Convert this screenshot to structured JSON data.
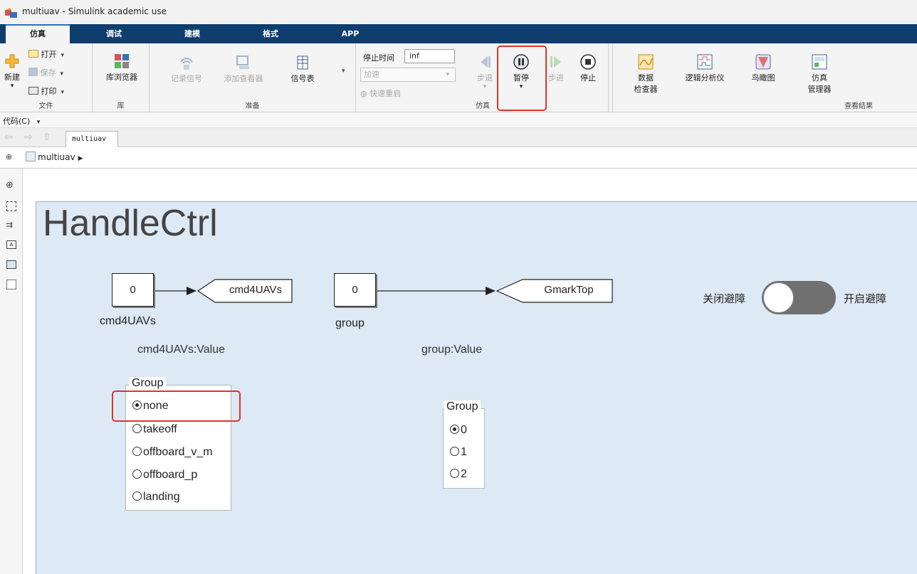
{
  "window": {
    "title": "multiuav - Simulink academic use"
  },
  "tabs": [
    {
      "label": "仿真",
      "active": true
    },
    {
      "label": "调试",
      "active": false
    },
    {
      "label": "建模",
      "active": false
    },
    {
      "label": "格式",
      "active": false
    },
    {
      "label": "APP",
      "active": false
    }
  ],
  "ribbon": {
    "file": {
      "new": "新建",
      "open": "打开",
      "save": "保存",
      "print": "打印",
      "section": "文件"
    },
    "library": {
      "browser": "库浏览器",
      "section": "库"
    },
    "prepare": {
      "record_signal": "记录信号",
      "add_viewer": "添加查看器",
      "signal_table": "信号表",
      "section": "准备"
    },
    "simulation": {
      "stop_time_label": "停止时间",
      "stop_time_value": "inf",
      "accel": "加速",
      "fast_restart": "快速重启",
      "step_back": "步退",
      "pause": "暂停",
      "step_forward": "步进",
      "stop": "停止",
      "section": "仿真"
    },
    "review": {
      "data_inspector_1": "数据",
      "data_inspector_2": "检查器",
      "logic_analyzer": "逻辑分析仪",
      "birds_eye": "鸟瞰图",
      "sim_manager_1": "仿真",
      "sim_manager_2": "管理器",
      "section": "查看结果"
    }
  },
  "code_menu": "代码(C)",
  "nav": {
    "tab": "multiuav"
  },
  "breadcrumb": {
    "model": "multiuav"
  },
  "diagram": {
    "area_title": "HandleCtrl",
    "block1": {
      "value": "0",
      "label": "cmd4UAVs",
      "goto": "cmd4UAVs",
      "display": "cmd4UAVs:Value"
    },
    "block2": {
      "value": "0",
      "label": "group",
      "goto": "GmarkTop",
      "display": "group:Value"
    },
    "radio1": {
      "legend": "Group",
      "options": [
        "none",
        "takeoff",
        "offboard_v_m",
        "offboard_p",
        "landing"
      ],
      "selected": "none"
    },
    "radio2": {
      "legend": "Group",
      "options": [
        "0",
        "1",
        "2"
      ],
      "selected": "0"
    },
    "switch": {
      "off_label": "关闭避障",
      "on_label": "开启避障",
      "state": "off"
    }
  },
  "colors": {
    "accent": "#0f3d6e",
    "highlight": "#e0342a",
    "area_bg": "#dde9f4"
  }
}
